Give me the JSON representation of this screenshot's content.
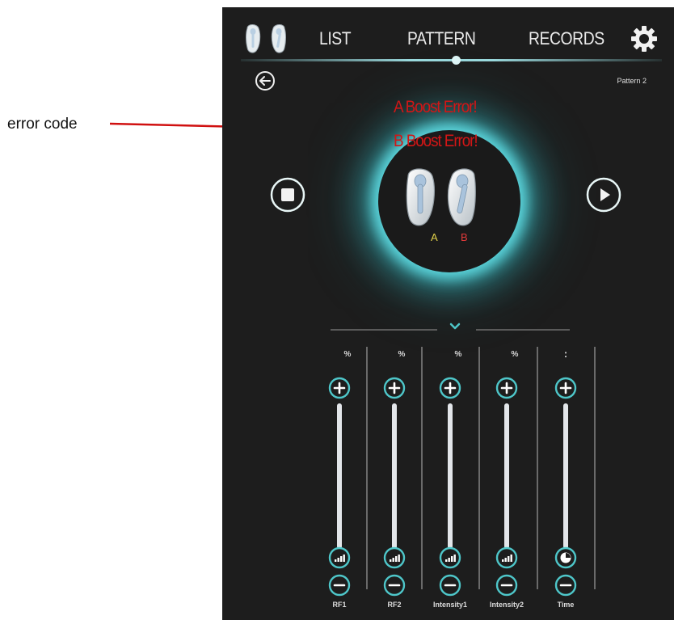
{
  "annotation": {
    "label": "error code"
  },
  "header": {
    "tabs": [
      {
        "label": "LIST"
      },
      {
        "label": "PATTERN"
      },
      {
        "label": "RECORDS"
      }
    ],
    "logo_icon": "twin-applicator-logo-icon",
    "settings_icon": "gear-icon"
  },
  "pattern": {
    "name": "Pattern 2"
  },
  "errors": {
    "a": "A Boost Error!",
    "b": "B Boost Error!"
  },
  "device": {
    "label_a": "A",
    "label_b": "B",
    "color_a": "#e1d14a",
    "color_b": "#e23a3a"
  },
  "controls": {
    "stop_icon": "stop-icon",
    "play_icon": "play-icon"
  },
  "sliders": [
    {
      "id": "rf1",
      "unit": "%",
      "label": "RF1",
      "bottom_icon": "signal-strength-icon"
    },
    {
      "id": "rf2",
      "unit": "%",
      "label": "RF2",
      "bottom_icon": "signal-strength-icon"
    },
    {
      "id": "intensity1",
      "unit": "%",
      "label": "Intensity1",
      "bottom_icon": "signal-strength-icon"
    },
    {
      "id": "intensity2",
      "unit": "%",
      "label": "Intensity2",
      "bottom_icon": "signal-strength-icon"
    },
    {
      "id": "time",
      "unit": ":",
      "label": "Time",
      "bottom_icon": "clock-icon"
    }
  ],
  "colors": {
    "accent": "#4ec6c9",
    "error": "#d21616",
    "background": "#1d1d1d"
  }
}
